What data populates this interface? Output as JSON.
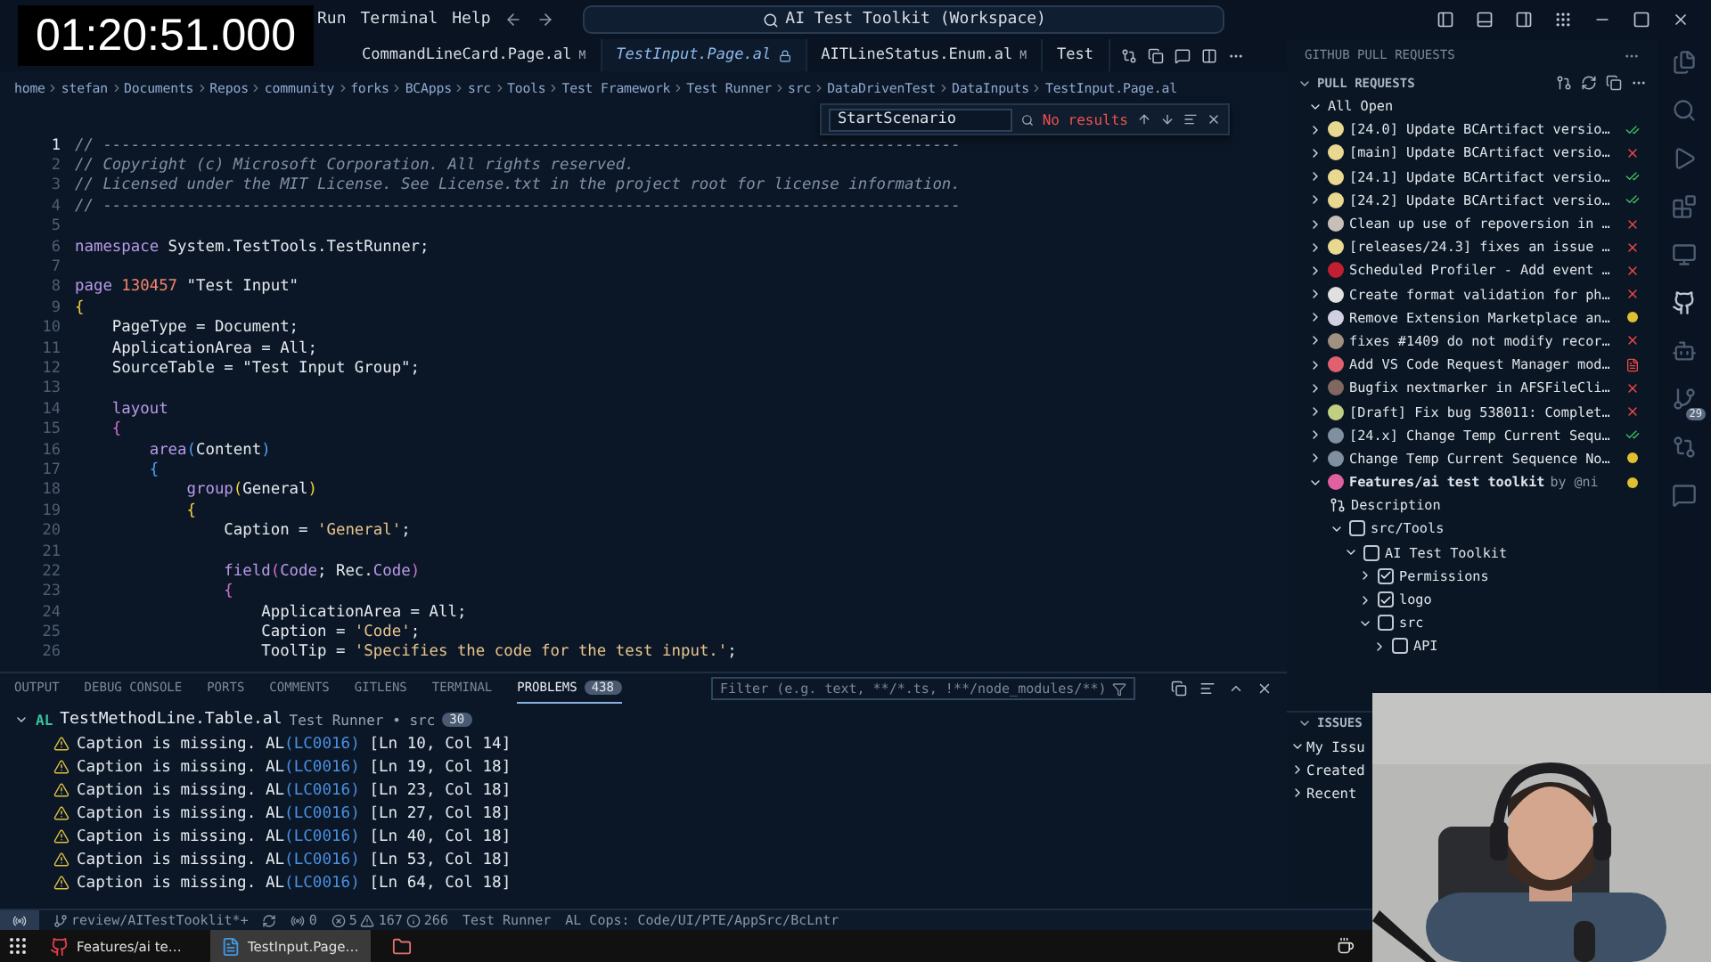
{
  "overlay_timer": "01:20:51.000",
  "menu": [
    "Run",
    "Terminal",
    "Help"
  ],
  "command_center": "AI Test Toolkit (Workspace)",
  "tabs": [
    {
      "label": "CommandLineCard.Page.al",
      "badge": "M",
      "selected": false
    },
    {
      "label": "TestInput.Page.al",
      "selected": true
    },
    {
      "label": "AITLineStatus.Enum.al",
      "badge": "M",
      "selected": false
    },
    {
      "label": "Test",
      "selected": false
    }
  ],
  "breadcrumb": [
    "home",
    "stefan",
    "Documents",
    "Repos",
    "community",
    "forks",
    "BCApps",
    "src",
    "Tools",
    "Test Framework",
    "Test Runner",
    "src",
    "DataDrivenTest",
    "DataInputs",
    "TestInput.Page.al"
  ],
  "find": {
    "value": "StartScenario",
    "result": "No results"
  },
  "code": [
    {
      "n": "1",
      "t": [
        {
          "kind": "comment",
          "text": "// --------------------------------------------------------------------------------------------"
        }
      ]
    },
    {
      "n": "2",
      "t": [
        {
          "kind": "comment",
          "text": "// Copyright (c) Microsoft Corporation. All rights reserved."
        }
      ]
    },
    {
      "n": "3",
      "t": [
        {
          "kind": "comment",
          "text": "// Licensed under the MIT License. See License.txt in the project root for license information."
        }
      ]
    },
    {
      "n": "4",
      "t": [
        {
          "kind": "comment",
          "text": "// --------------------------------------------------------------------------------------------"
        }
      ]
    },
    {
      "n": "5"
    },
    {
      "n": "6",
      "t": [
        {
          "kind": "keyword",
          "text": "namespace"
        },
        {
          "kind": "plain",
          "text": " System.TestTools.TestRunner;"
        }
      ]
    },
    {
      "n": "7"
    },
    {
      "n": "8",
      "t": [
        {
          "kind": "keyword",
          "text": "page"
        },
        {
          "kind": "number",
          "text": " 130457"
        },
        {
          "kind": "plain",
          "text": " \"Test Input\""
        }
      ]
    },
    {
      "n": "9",
      "t": [
        {
          "kind": "brace1",
          "text": "{"
        }
      ]
    },
    {
      "n": "10",
      "t": [
        {
          "kind": "plain",
          "text": "    PageType = Document;"
        }
      ]
    },
    {
      "n": "11",
      "t": [
        {
          "kind": "plain",
          "text": "    ApplicationArea = All;"
        }
      ]
    },
    {
      "n": "12",
      "t": [
        {
          "kind": "plain",
          "text": "    SourceTable = \"Test Input Group\";"
        }
      ]
    },
    {
      "n": "13"
    },
    {
      "n": "14",
      "t": [
        {
          "kind": "keyword",
          "text": "    layout"
        }
      ]
    },
    {
      "n": "15",
      "t": [
        {
          "kind": "brace2",
          "text": "    {"
        }
      ]
    },
    {
      "n": "16",
      "t": [
        {
          "kind": "keyword",
          "text": "        area"
        },
        {
          "kind": "brace3",
          "text": "("
        },
        {
          "kind": "plain",
          "text": "Content"
        },
        {
          "kind": "brace3",
          "text": ")"
        }
      ]
    },
    {
      "n": "17",
      "t": [
        {
          "kind": "brace3",
          "text": "        {"
        }
      ]
    },
    {
      "n": "18",
      "t": [
        {
          "kind": "keyword",
          "text": "            group"
        },
        {
          "kind": "brace1",
          "text": "("
        },
        {
          "kind": "plain",
          "text": "General"
        },
        {
          "kind": "brace1",
          "text": ")"
        }
      ]
    },
    {
      "n": "19",
      "t": [
        {
          "kind": "brace1",
          "text": "            {"
        }
      ]
    },
    {
      "n": "20",
      "t": [
        {
          "kind": "plain",
          "text": "                Caption = "
        },
        {
          "kind": "string",
          "text": "'General'"
        },
        {
          "kind": "plain",
          "text": ";"
        }
      ]
    },
    {
      "n": "21"
    },
    {
      "n": "22",
      "t": [
        {
          "kind": "keyword",
          "text": "                field"
        },
        {
          "kind": "brace2",
          "text": "("
        },
        {
          "kind": "keyword",
          "text": "Code"
        },
        {
          "kind": "plain",
          "text": "; Rec."
        },
        {
          "kind": "keyword",
          "text": "Code"
        },
        {
          "kind": "brace2",
          "text": ")"
        }
      ]
    },
    {
      "n": "23",
      "t": [
        {
          "kind": "brace2",
          "text": "                {"
        }
      ]
    },
    {
      "n": "24",
      "t": [
        {
          "kind": "plain",
          "text": "                    ApplicationArea = All;"
        }
      ]
    },
    {
      "n": "25",
      "t": [
        {
          "kind": "plain",
          "text": "                    Caption = "
        },
        {
          "kind": "string",
          "text": "'Code'"
        },
        {
          "kind": "plain",
          "text": ";"
        }
      ]
    },
    {
      "n": "26",
      "t": [
        {
          "kind": "plain",
          "text": "                    ToolTip = "
        },
        {
          "kind": "string",
          "text": "'Specifies the code for the test input.'"
        },
        {
          "kind": "plain",
          "text": ";"
        }
      ]
    }
  ],
  "panel": {
    "tabs": [
      {
        "label": "OUTPUT",
        "selected": false
      },
      {
        "label": "DEBUG CONSOLE",
        "selected": false
      },
      {
        "label": "PORTS",
        "selected": false
      },
      {
        "label": "COMMENTS",
        "selected": false
      },
      {
        "label": "GITLENS",
        "selected": false
      },
      {
        "label": "TERMINAL",
        "selected": false
      },
      {
        "label": "PROBLEMS",
        "count": "438",
        "selected": true
      }
    ],
    "filter_placeholder": "Filter (e.g. text, **/*.ts, !**/node_modules/**)",
    "file": {
      "lang": "AL",
      "name": "TestMethodLine.Table.al",
      "path": "Test Runner • src",
      "count": "30",
      "expanded": true
    },
    "problems": [
      {
        "message": "Caption is missing.",
        "source": "AL",
        "code": "(LC0016)",
        "location": "[Ln 10, Col 14]"
      },
      {
        "message": "Caption is missing.",
        "source": "AL",
        "code": "(LC0016)",
        "location": "[Ln 19, Col 18]"
      },
      {
        "message": "Caption is missing.",
        "source": "AL",
        "code": "(LC0016)",
        "location": "[Ln 23, Col 18]"
      },
      {
        "message": "Caption is missing.",
        "source": "AL",
        "code": "(LC0016)",
        "location": "[Ln 27, Col 18]"
      },
      {
        "message": "Caption is missing.",
        "source": "AL",
        "code": "(LC0016)",
        "location": "[Ln 40, Col 18]"
      },
      {
        "message": "Caption is missing.",
        "source": "AL",
        "code": "(LC0016)",
        "location": "[Ln 53, Col 18]"
      },
      {
        "message": "Caption is missing.",
        "source": "AL",
        "code": "(LC0016)",
        "location": "[Ln 64, Col 18]"
      }
    ]
  },
  "sidebar": {
    "title": "GITHUB PULL REQUESTS",
    "section": "PULL REQUESTS",
    "group": "All Open",
    "pull_requests": [
      {
        "title": "[24.0] Update BCArtifact versio…",
        "kind": "passed",
        "color": "#e8d890",
        "expanded": false
      },
      {
        "title": "[main] Update BCArtifact versio…",
        "kind": "failed",
        "color": "#e8d890",
        "expanded": false
      },
      {
        "title": "[24.1] Update BCArtifact versio…",
        "kind": "passed",
        "color": "#e8d890",
        "expanded": false
      },
      {
        "title": "[24.2] Update BCArtifact versio…",
        "kind": "passed",
        "color": "#e8d890",
        "expanded": false
      },
      {
        "title": "Clean up use of repoversion in …",
        "kind": "failed",
        "color": "#c8c0b8",
        "expanded": false
      },
      {
        "title": "[releases/24.3] fixes an issue …",
        "kind": "failed",
        "color": "#e8d890",
        "expanded": false
      },
      {
        "title": "Scheduled Profiler - Add event …",
        "kind": "failed",
        "color": "#c02030",
        "expanded": false
      },
      {
        "title": "Create format validation for ph…",
        "kind": "failed",
        "color": "#e0e0e0",
        "expanded": false
      },
      {
        "title": "Remove Extension Marketplace an…",
        "kind": "pending",
        "color": "#d0d0e0",
        "expanded": false
      },
      {
        "title": "fixes #1409 do not modify recor…",
        "kind": "failed",
        "color": "#a09080",
        "expanded": false
      },
      {
        "title": "Add VS Code Request Manager mod…",
        "kind": "changes",
        "color": "#e06070",
        "expanded": false
      },
      {
        "title": "Bugfix nextmarker in AFSFileCli…",
        "kind": "failed",
        "color": "#806860",
        "expanded": false
      },
      {
        "title": "[Draft] Fix bug 538011: Complet…",
        "kind": "failed",
        "color": "#c0d080",
        "expanded": false
      },
      {
        "title": "[24.x] Change Temp Current Sequ…",
        "kind": "passed",
        "color": "#8090a0",
        "expanded": false
      },
      {
        "title": "Change Temp Current Sequence No…",
        "kind": "pending",
        "color": "#8090a0",
        "expanded": false
      },
      {
        "title": "Features/ai test toolkit",
        "author": "by @ni",
        "kind": "pending",
        "color": "#e060a0",
        "expanded": true,
        "children": [
          {
            "kind": "description",
            "label": "Description"
          },
          {
            "kind": "folder",
            "label": "src/Tools",
            "checked": false,
            "expanded": true,
            "children": [
              {
                "kind": "folder",
                "label": "AI Test Toolkit",
                "checked": false,
                "expanded": true,
                "children": [
                  {
                    "kind": "folder",
                    "label": "Permissions",
                    "checked": true,
                    "expanded": false
                  },
                  {
                    "kind": "folder",
                    "label": "logo",
                    "checked": true,
                    "expanded": false
                  },
                  {
                    "kind": "folder",
                    "label": "src",
                    "checked": false,
                    "expanded": true,
                    "children": [
                      {
                        "kind": "folder",
                        "label": "API",
                        "checked": false,
                        "expanded": false
                      }
                    ]
                  }
                ]
              }
            ]
          }
        ]
      }
    ],
    "issues": {
      "title": "ISSUES",
      "items": [
        {
          "label": "My Issu",
          "expanded": true
        },
        {
          "label": "Created",
          "expanded": false
        },
        {
          "label": "Recent",
          "expanded": false
        }
      ]
    }
  },
  "activity_badge": "29",
  "status_bar": {
    "branch": "review/AITestTooklit*+",
    "ports": "0",
    "errors": "5",
    "warnings": "167",
    "infos": "266",
    "project": "Test Runner",
    "cops": "AL Cops: Code/UI/PTE/AppSrc/BcLntr"
  },
  "taskbar": [
    {
      "label": "Features/ai te…",
      "kind": "browser",
      "selected": false
    },
    {
      "label": "TestInput.Page…",
      "kind": "editor",
      "selected": true
    },
    {
      "kind": "files",
      "selected": false
    }
  ],
  "webcam": {
    "kind": "picture"
  }
}
